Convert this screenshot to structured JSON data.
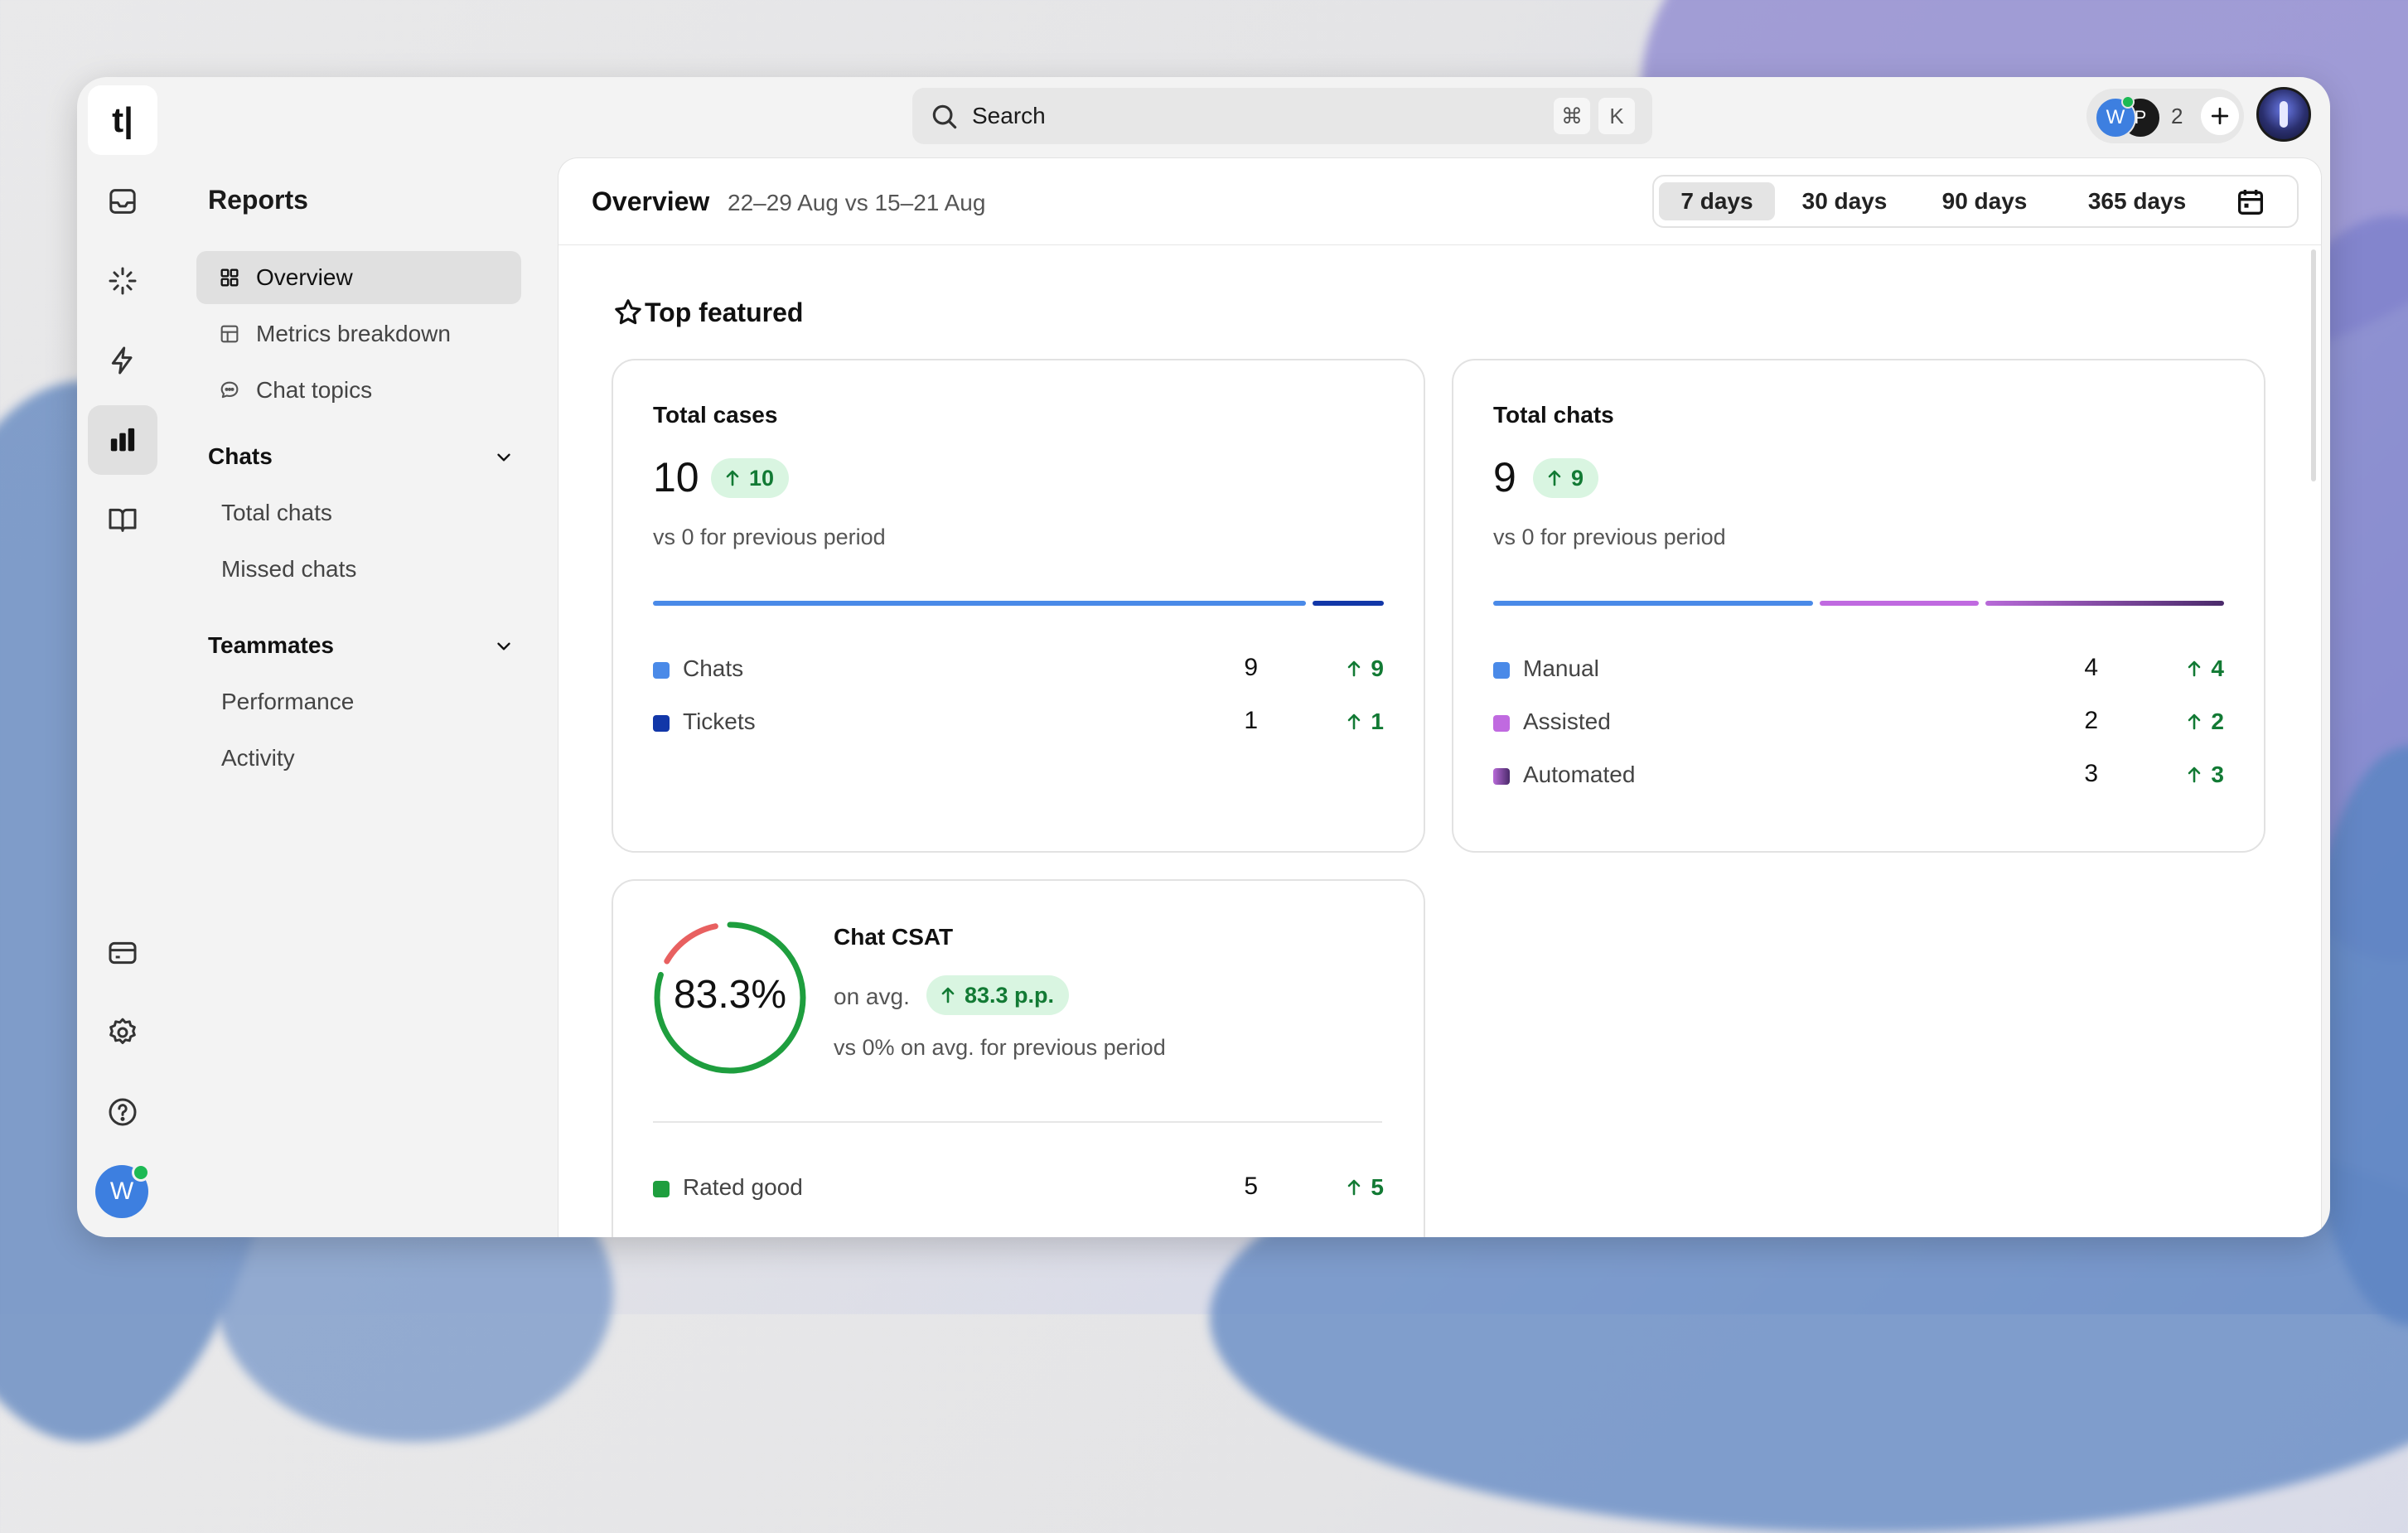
{
  "app": {
    "logo": "t|"
  },
  "rail": {
    "icons": [
      "inbox-icon",
      "sparkle-icon",
      "bolt-icon",
      "chart-icon",
      "book-icon",
      "billing-icon",
      "settings-icon",
      "help-icon"
    ],
    "active": "chart-icon",
    "user_initial": "W"
  },
  "search": {
    "placeholder": "Search",
    "kbd1": "⌘",
    "kbd2": "K"
  },
  "presence": {
    "avatar1": "W",
    "avatar2": "P",
    "count": "2"
  },
  "nav": {
    "title": "Reports",
    "items": [
      {
        "label": "Overview",
        "icon": "grid-icon",
        "active": true
      },
      {
        "label": "Metrics breakdown",
        "icon": "table-icon"
      },
      {
        "label": "Chat topics",
        "icon": "speech-bubble-icon"
      }
    ],
    "groups": [
      {
        "label": "Chats",
        "items": [
          "Total chats",
          "Missed chats"
        ]
      },
      {
        "label": "Teammates",
        "items": [
          "Performance",
          "Activity"
        ]
      }
    ]
  },
  "header": {
    "title": "Overview",
    "range": "22–29 Aug vs 15–21 Aug",
    "ranges": [
      "7 days",
      "30 days",
      "90 days",
      "365 days"
    ],
    "active_range": "7 days"
  },
  "section": {
    "title": "Top featured"
  },
  "colors": {
    "chats": "#4a8ae8",
    "tickets": "#1237a8",
    "manual": "#4a8ae8",
    "assisted": "#c06ae0",
    "automated_from": "#b86ad8",
    "automated_to": "#4a2a6a",
    "good": "#1e9e3e",
    "bad": "#e86060",
    "delta_green": "#127a34"
  },
  "total_cases": {
    "title": "Total cases",
    "value": "10",
    "delta": "10",
    "sub": "vs 0 for previous period",
    "rows": [
      {
        "label": "Chats",
        "value": "9",
        "delta": "9"
      },
      {
        "label": "Tickets",
        "value": "1",
        "delta": "1"
      }
    ]
  },
  "total_chats": {
    "title": "Total chats",
    "value": "9",
    "delta": "9",
    "sub": "vs 0 for previous period",
    "rows": [
      {
        "label": "Manual",
        "value": "4",
        "delta": "4"
      },
      {
        "label": "Assisted",
        "value": "2",
        "delta": "2"
      },
      {
        "label": "Automated",
        "value": "3",
        "delta": "3"
      }
    ]
  },
  "csat": {
    "title": "Chat CSAT",
    "percent": "83.3%",
    "percent_value": 0.833,
    "on_avg": "on avg.",
    "delta": "83.3 p.p.",
    "sub": "vs 0% on avg. for previous period",
    "rows": [
      {
        "label": "Rated good",
        "value": "5",
        "delta": "5"
      }
    ]
  }
}
